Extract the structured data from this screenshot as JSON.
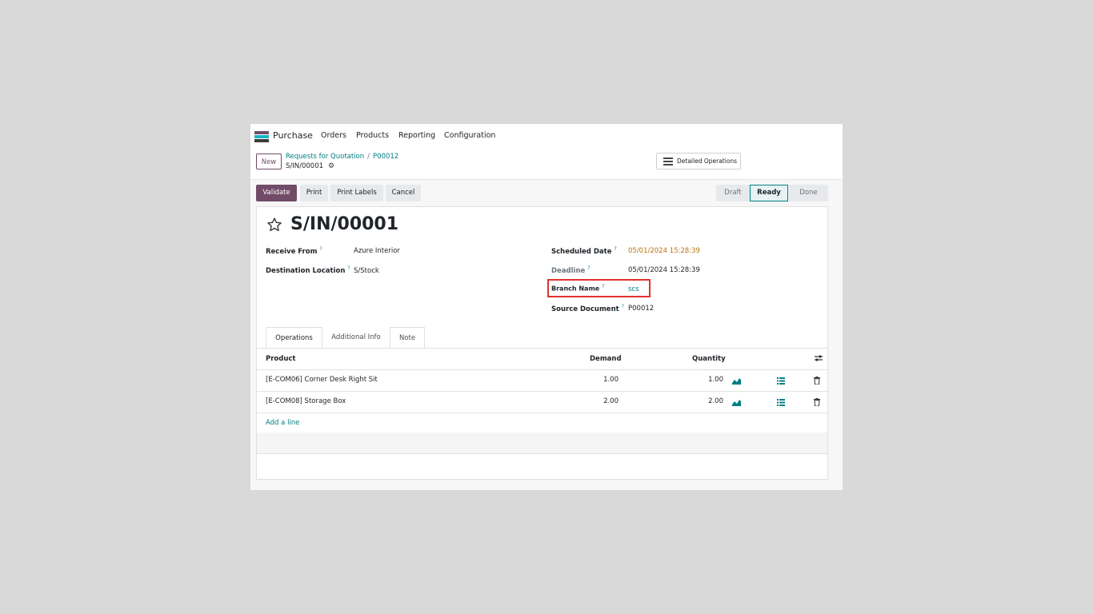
{
  "app": {
    "name": "Purchase"
  },
  "nav": {
    "orders": "Orders",
    "products": "Products",
    "reporting": "Reporting",
    "configuration": "Configuration"
  },
  "control": {
    "new_label": "New",
    "breadcrumb": [
      "Requests for Quotation",
      "P00012"
    ],
    "breadcrumb_sep": "/",
    "record": "S/IN/00001",
    "detailed_operations": "Detailed Operations"
  },
  "actions": {
    "validate": "Validate",
    "print": "Print",
    "print_labels": "Print Labels",
    "cancel": "Cancel"
  },
  "status": {
    "stages": [
      "Draft",
      "Ready",
      "Done"
    ],
    "current": "Ready"
  },
  "form": {
    "title": "S/IN/00001",
    "receive_from_label": "Receive From",
    "receive_from": "Azure Interior",
    "destination_label": "Destination Location",
    "destination": "S/Stock",
    "scheduled_label": "Scheduled Date",
    "scheduled": "05/01/2024 15:28:39",
    "deadline_label": "Deadline",
    "deadline": "05/01/2024 15:28:39",
    "branch_label": "Branch Name",
    "branch": "scs",
    "source_label": "Source Document",
    "source": "P00012",
    "help": "?"
  },
  "tabs": [
    "Operations",
    "Additional Info",
    "Note"
  ],
  "table": {
    "headers": {
      "product": "Product",
      "demand": "Demand",
      "quantity": "Quantity"
    },
    "rows": [
      {
        "product": "[E-COM06] Corner Desk Right Sit",
        "demand": "1.00",
        "quantity": "1.00"
      },
      {
        "product": "[E-COM08] Storage Box",
        "demand": "2.00",
        "quantity": "2.00"
      }
    ],
    "add_line": "Add a line"
  },
  "colors": {
    "brand": "#714b67",
    "accent": "#017e84",
    "highlight": "#e0322e",
    "date_warning": "#b8730e"
  }
}
